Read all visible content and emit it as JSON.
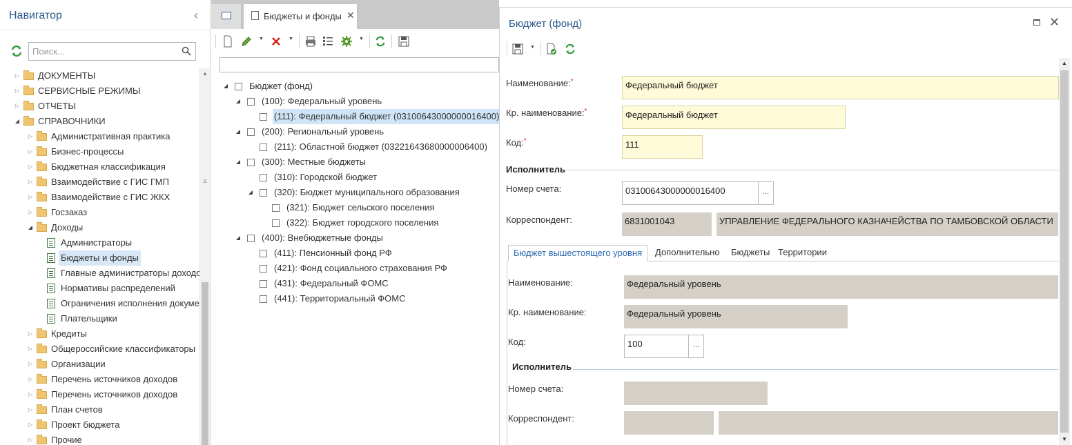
{
  "navigator": {
    "title": "Навигатор",
    "search_placeholder": "Поиск...",
    "items": [
      {
        "label": "ДОКУМЕНТЫ"
      },
      {
        "label": "СЕРВИСНЫЕ РЕЖИМЫ"
      },
      {
        "label": "ОТЧЕТЫ"
      },
      {
        "label": "СПРАВОЧНИКИ"
      },
      {
        "label": "Административная практика"
      },
      {
        "label": "Бизнес-процессы"
      },
      {
        "label": "Бюджетная классификация"
      },
      {
        "label": "Взаимодействие с ГИС ГМП"
      },
      {
        "label": "Взаимодействие с ГИС ЖКХ"
      },
      {
        "label": "Госзаказ"
      },
      {
        "label": "Доходы"
      },
      {
        "label": "Администраторы"
      },
      {
        "label": "Бюджеты и фонды"
      },
      {
        "label": "Главные администраторы доходов"
      },
      {
        "label": "Нормативы распределений"
      },
      {
        "label": "Ограничения исполнения документов"
      },
      {
        "label": "Плательщики"
      },
      {
        "label": "Кредиты"
      },
      {
        "label": "Общероссийские классификаторы"
      },
      {
        "label": "Организации"
      },
      {
        "label": "Перечень источников доходов"
      },
      {
        "label": "Перечень источников доходов"
      },
      {
        "label": "План счетов"
      },
      {
        "label": "Проект бюджета"
      },
      {
        "label": "Прочие"
      }
    ]
  },
  "tabs": {
    "active_label": "Бюджеты и фонды",
    "close_glyph": "✕"
  },
  "tree": {
    "nodes": [
      {
        "label": "Бюджет (фонд)"
      },
      {
        "label": "(100): Федеральный уровень"
      },
      {
        "label": "(111): Федеральный бюджет (03100643000000016400)"
      },
      {
        "label": "(200): Региональный уровень"
      },
      {
        "label": "(211): Областной бюджет (03221643680000006400)"
      },
      {
        "label": "(300): Местные бюджеты"
      },
      {
        "label": "(310): Городской бюджет"
      },
      {
        "label": "(320): Бюджет муниципального образования"
      },
      {
        "label": "(321): Бюджет сельского поселения"
      },
      {
        "label": "(322): Бюджет городского поселения"
      },
      {
        "label": "(400): Внебюджетные фонды"
      },
      {
        "label": "(411): Пенсионный фонд РФ"
      },
      {
        "label": "(421): Фонд социального страхования РФ"
      },
      {
        "label": "(431): Федеральный ФОМС"
      },
      {
        "label": "(441): Территориальный ФОМС"
      }
    ]
  },
  "form": {
    "title": "Бюджет (фонд)",
    "name_label": "Наименование:",
    "name_value": "Федеральный бюджет",
    "short_name_label": "Кр. наименование:",
    "short_name_value": "Федеральный бюджет",
    "code_label": "Код:",
    "code_value": "111",
    "required_mark": "*",
    "executor_section": "Исполнитель",
    "account_label": "Номер счета:",
    "account_value": "03100643000000016400",
    "correspondent_label": "Корреспондент:",
    "correspondent_inn": "6831001043",
    "correspondent_name": "УПРАВЛЕНИЕ ФЕДЕРАЛЬНОГО КАЗНАЧЕЙСТВА ПО ТАМБОВСКОЙ ОБЛАСТИ",
    "ellipsis": "...",
    "tabs": [
      "Бюджет вышестоящего уровня",
      "Дополнительно",
      "Бюджеты",
      "Территории"
    ],
    "parent": {
      "name_label": "Наименование:",
      "name_value": "Федеральный уровень",
      "short_name_label": "Кр. наименование:",
      "short_name_value": "Федеральный уровень",
      "code_label": "Код:",
      "code_value": "100",
      "executor_section": "Исполнитель",
      "account_label": "Номер счета:",
      "account_value": "",
      "correspondent_label": "Корреспондент:",
      "correspondent_inn": "",
      "correspondent_name": ""
    }
  },
  "colors": {
    "accent": "#2c5a8a",
    "required": "#d8262e",
    "editable_field": "#fffbd9",
    "readonly_field": "#d4d0c8",
    "selection": "#cfe4f6"
  }
}
